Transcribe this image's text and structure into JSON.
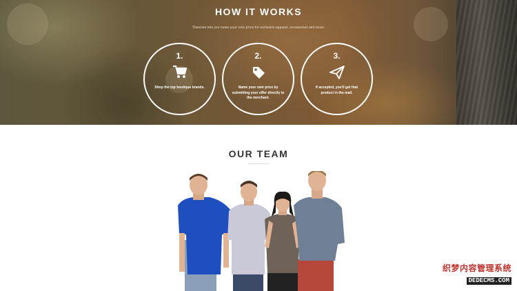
{
  "hero": {
    "title": "HOW IT WORKS",
    "subtitle": "Theorem lets you name your own price for exclusive apparel, accessories and more.",
    "steps": [
      {
        "number": "1.",
        "icon": "shopping-cart-icon",
        "text": "Shop the top boutique brands."
      },
      {
        "number": "2.",
        "icon": "price-tag-icon",
        "text": "Name your own price by submitting your offer directly to the merchant."
      },
      {
        "number": "3.",
        "icon": "paper-plane-icon",
        "text": "If accepted, you'll get that product in the mail."
      }
    ]
  },
  "team": {
    "title": "OUR TEAM",
    "members": [
      {
        "shirt": "#1f4fbf",
        "pants": "#8aa0b8"
      },
      {
        "shirt": "#c9c9d8",
        "pants": "#3b4a66"
      },
      {
        "shirt": "#6f6258",
        "pants": "#222222"
      },
      {
        "shirt": "#6f7f96",
        "pants": "#b5473b"
      }
    ]
  },
  "watermark": {
    "chinese": "织梦内容管理系统",
    "english": "DEDECMS.COM"
  },
  "colors": {
    "hero_text": "#ffffff",
    "heading_dark": "#333333",
    "watermark_red": "#c0322b"
  }
}
